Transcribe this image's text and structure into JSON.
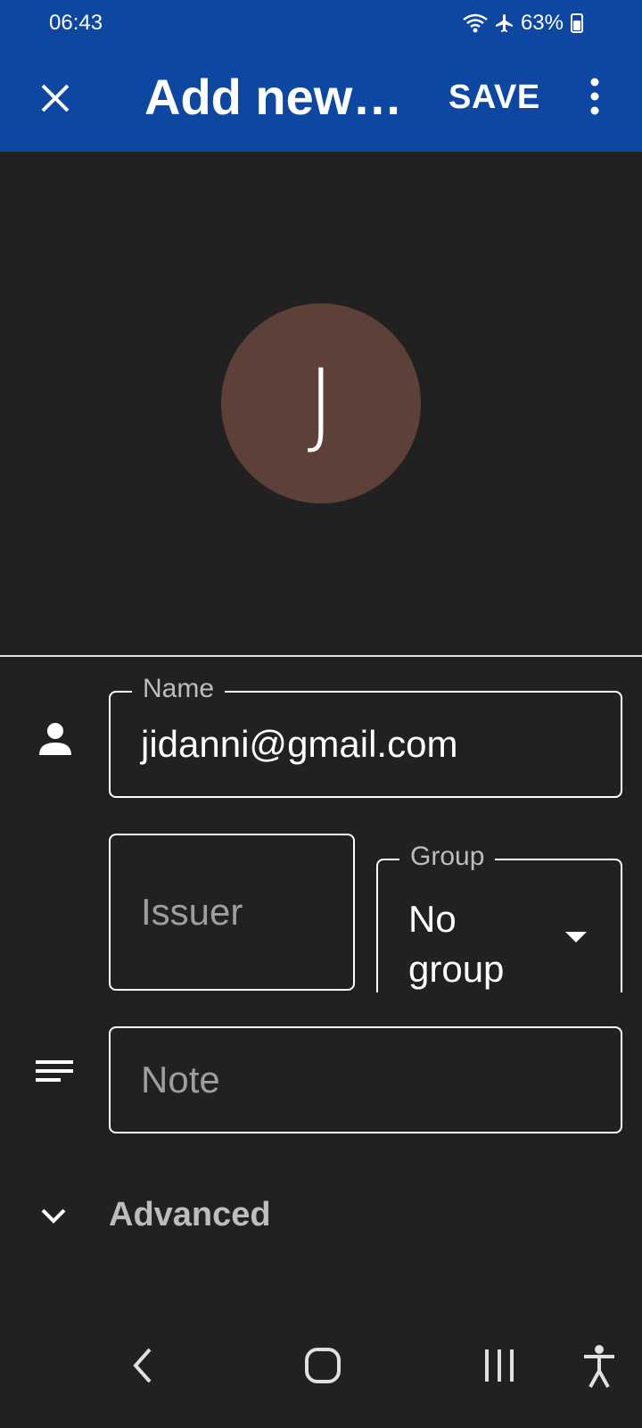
{
  "status_bar": {
    "time": "06:43",
    "battery_percent": "63%",
    "icons": [
      "wifi-icon",
      "airplane-icon",
      "battery-icon"
    ]
  },
  "app_bar": {
    "title": "Add new…",
    "save_label": "SAVE",
    "icons": [
      "close-icon",
      "more-vert-icon"
    ],
    "background_color": "#0d47a1"
  },
  "avatar": {
    "letter": "J",
    "color": "#5d4037"
  },
  "form": {
    "name": {
      "label": "Name",
      "value": "jidanni@gmail.com",
      "icon": "person-icon"
    },
    "issuer": {
      "placeholder": "Issuer"
    },
    "group": {
      "label": "Group",
      "value": "No group"
    },
    "note": {
      "placeholder": "Note",
      "icon": "notes-icon"
    },
    "advanced": {
      "label": "Advanced",
      "icon": "chevron-down-icon"
    }
  },
  "nav_bar": {
    "icons": [
      "back-icon",
      "home-icon",
      "recents-icon",
      "accessibility-icon"
    ]
  }
}
